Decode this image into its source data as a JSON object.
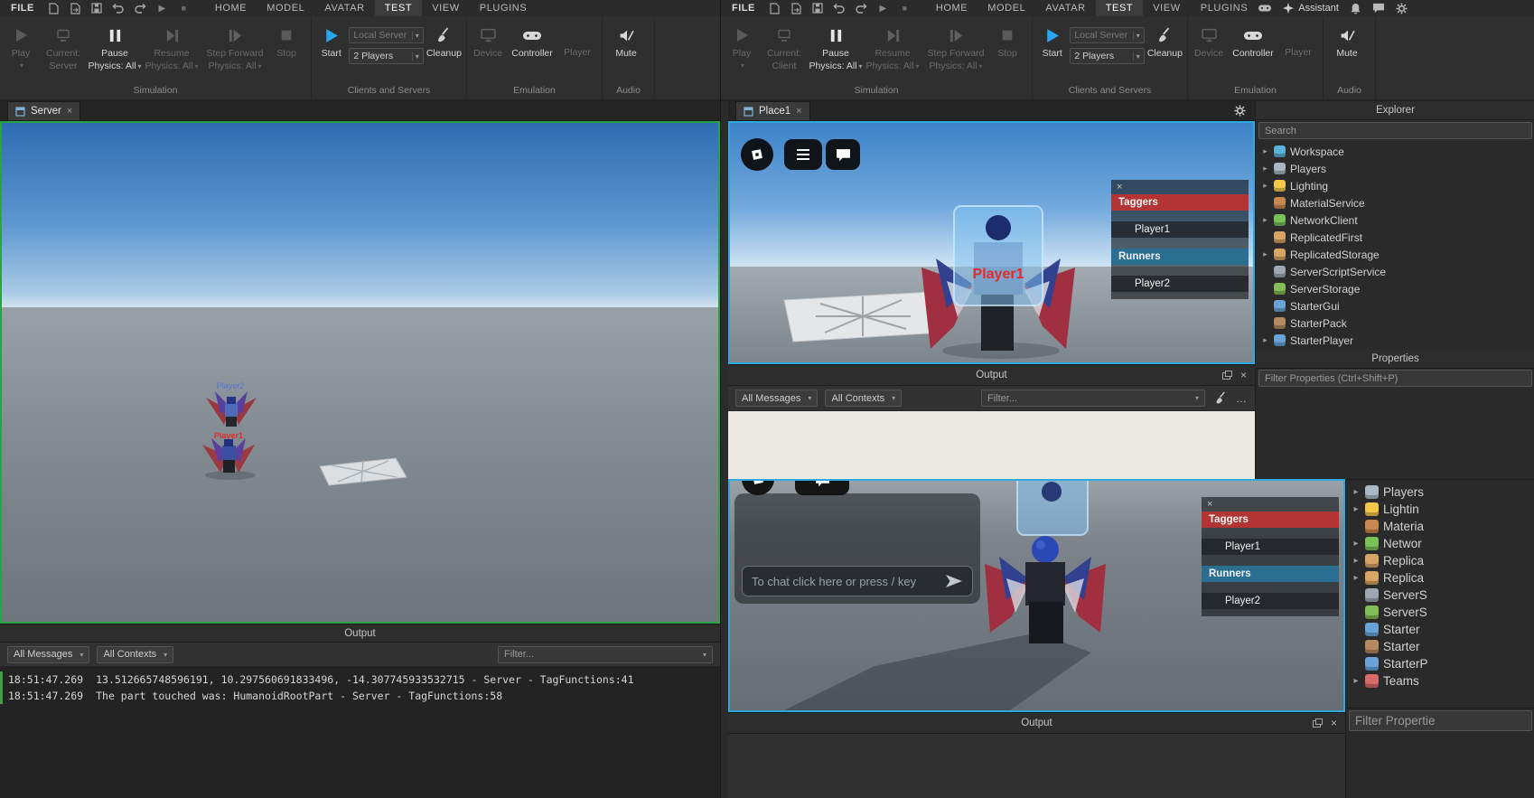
{
  "icons": {
    "dropdown_arrow": "▾",
    "chevron_right": "▸",
    "close": "×",
    "ellipsis": "…",
    "play": "▶",
    "stop": "■"
  },
  "colors": {
    "server_border": "#2aa344",
    "client_border": "#2da9e0",
    "taggers_red": "#b23434",
    "runners_blue": "#2a6e92",
    "start_blue": "#2aa6f2",
    "player1_red": "#e02b2b",
    "player2_blue": "#5b6fd6"
  },
  "menubar": {
    "file": "FILE",
    "menus": [
      "HOME",
      "MODEL",
      "AVATAR",
      "TEST",
      "VIEW",
      "PLUGINS"
    ],
    "active_menu": "TEST",
    "assistant_label": "Assistant"
  },
  "ribbon": {
    "play": "Play",
    "current_prefix": "Current:",
    "current_server": "Server",
    "current_client": "Client",
    "pause_line1": "Pause",
    "pause_line2": "Physics: All",
    "resume_line1": "Resume",
    "resume_line2": "Physics: All",
    "step_line1": "Step Forward",
    "step_line2": "Physics: All",
    "stop": "Stop",
    "start": "Start",
    "local_server": "Local Server",
    "num_players": "2 Players",
    "cleanup": "Cleanup",
    "device": "Device",
    "controller": "Controller",
    "player": "Player",
    "mute": "Mute",
    "sections": {
      "simulation": "Simulation",
      "clients_servers": "Clients and Servers",
      "emulation": "Emulation",
      "audio": "Audio"
    }
  },
  "left_window": {
    "tab": "Server",
    "viewport": {
      "player2_name": "Player2",
      "player1_name": "Player1"
    },
    "output": {
      "title": "Output",
      "messages_dropdown": "All Messages",
      "contexts_dropdown": "All Contexts",
      "filter_placeholder": "Filter...",
      "log": [
        {
          "time": "18:51:47.269",
          "message": "13.512665748596191, 10.297560691833496, -14.307745933532715  -  Server - TagFunctions:41"
        },
        {
          "time": "18:51:47.269",
          "message": "The part touched was: HumanoidRootPart  -  Server - TagFunctions:58"
        }
      ]
    }
  },
  "right_window": {
    "tab": "Place1",
    "game_ui": {
      "player1_name": "Player1",
      "chat_placeholder": "To chat click here or press / key",
      "leaderboard": {
        "team1": "Taggers",
        "team1_member": "Player1",
        "team2": "Runners",
        "team2_member": "Player2"
      }
    },
    "output": {
      "title": "Output",
      "messages_dropdown": "All Messages",
      "contexts_dropdown": "All Contexts",
      "filter_placeholder": "Filter..."
    },
    "explorer": {
      "title": "Explorer",
      "search_placeholder": "Search",
      "items": [
        {
          "label": "Workspace",
          "color": "#59b3dc",
          "expandable": true
        },
        {
          "label": "Players",
          "color": "#aab8c5",
          "expandable": true
        },
        {
          "label": "Lighting",
          "color": "#f3c84a",
          "expandable": true
        },
        {
          "label": "MaterialService",
          "color": "#c8874e",
          "expandable": false
        },
        {
          "label": "NetworkClient",
          "color": "#79c157",
          "expandable": true
        },
        {
          "label": "ReplicatedFirst",
          "color": "#d7a566",
          "expandable": false
        },
        {
          "label": "ReplicatedStorage",
          "color": "#d7a566",
          "expandable": true
        },
        {
          "label": "ServerScriptService",
          "color": "#9fa8b2",
          "expandable": false
        },
        {
          "label": "ServerStorage",
          "color": "#83bd57",
          "expandable": false
        },
        {
          "label": "StarterGui",
          "color": "#6aa3d8",
          "expandable": false
        },
        {
          "label": "StarterPack",
          "color": "#b68a60",
          "expandable": false
        },
        {
          "label": "StarterPlayer",
          "color": "#6aa3d8",
          "expandable": true
        }
      ]
    },
    "properties": {
      "title": "Properties",
      "filter_placeholder": "Filter Properties (Ctrl+Shift+P)"
    }
  },
  "bottom_window": {
    "output_title": "Output",
    "properties_filter": "Filter Propertie",
    "explorer_items": [
      {
        "label": "Players",
        "color": "#aab8c5",
        "expandable": true
      },
      {
        "label": "Lightin",
        "color": "#f3c84a",
        "expandable": true
      },
      {
        "label": "Materia",
        "color": "#c8874e",
        "expandable": false
      },
      {
        "label": "Networ",
        "color": "#79c157",
        "expandable": true
      },
      {
        "label": "Replica",
        "color": "#d7a566",
        "expandable": true
      },
      {
        "label": "Replica",
        "color": "#d7a566",
        "expandable": true
      },
      {
        "label": "ServerS",
        "color": "#9fa8b2",
        "expandable": false
      },
      {
        "label": "ServerS",
        "color": "#83bd57",
        "expandable": false
      },
      {
        "label": "Starter",
        "color": "#6aa3d8",
        "expandable": false
      },
      {
        "label": "Starter",
        "color": "#b68a60",
        "expandable": false
      },
      {
        "label": "StarterP",
        "color": "#6aa3d8",
        "expandable": false
      },
      {
        "label": "Teams",
        "color": "#d86a6a",
        "expandable": true
      }
    ]
  }
}
